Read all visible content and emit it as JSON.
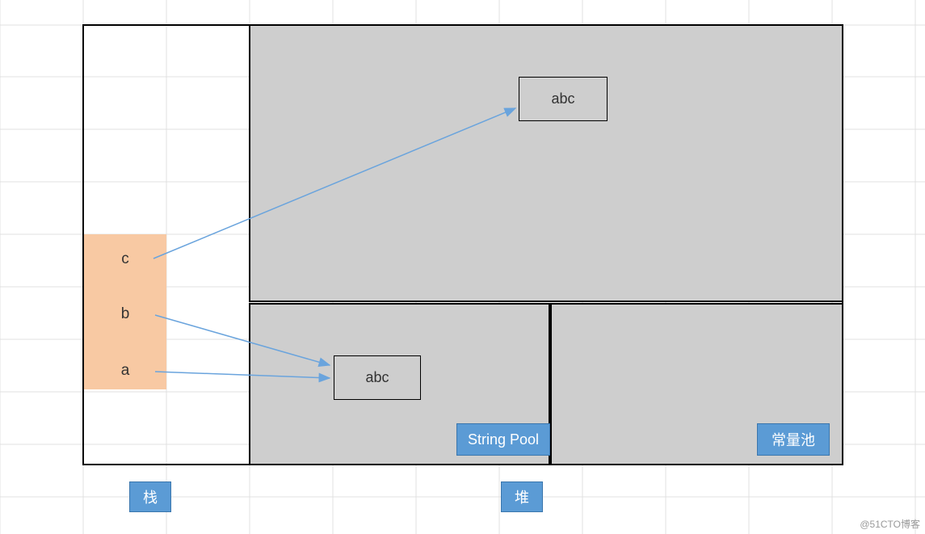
{
  "diagram": {
    "stack": {
      "vars": [
        "c",
        "b",
        "a"
      ]
    },
    "heap": {
      "top_object": "abc",
      "string_pool": {
        "label": "String Pool",
        "entry": "abc"
      },
      "constant_pool": {
        "label": "常量池"
      }
    },
    "labels": {
      "stack": "栈",
      "heap": "堆"
    },
    "arrows": [
      {
        "from": "c",
        "to": "heap_top_abc"
      },
      {
        "from": "b",
        "to": "string_pool_abc"
      },
      {
        "from": "a",
        "to": "string_pool_abc"
      }
    ]
  },
  "watermark": "@51CTO博客"
}
